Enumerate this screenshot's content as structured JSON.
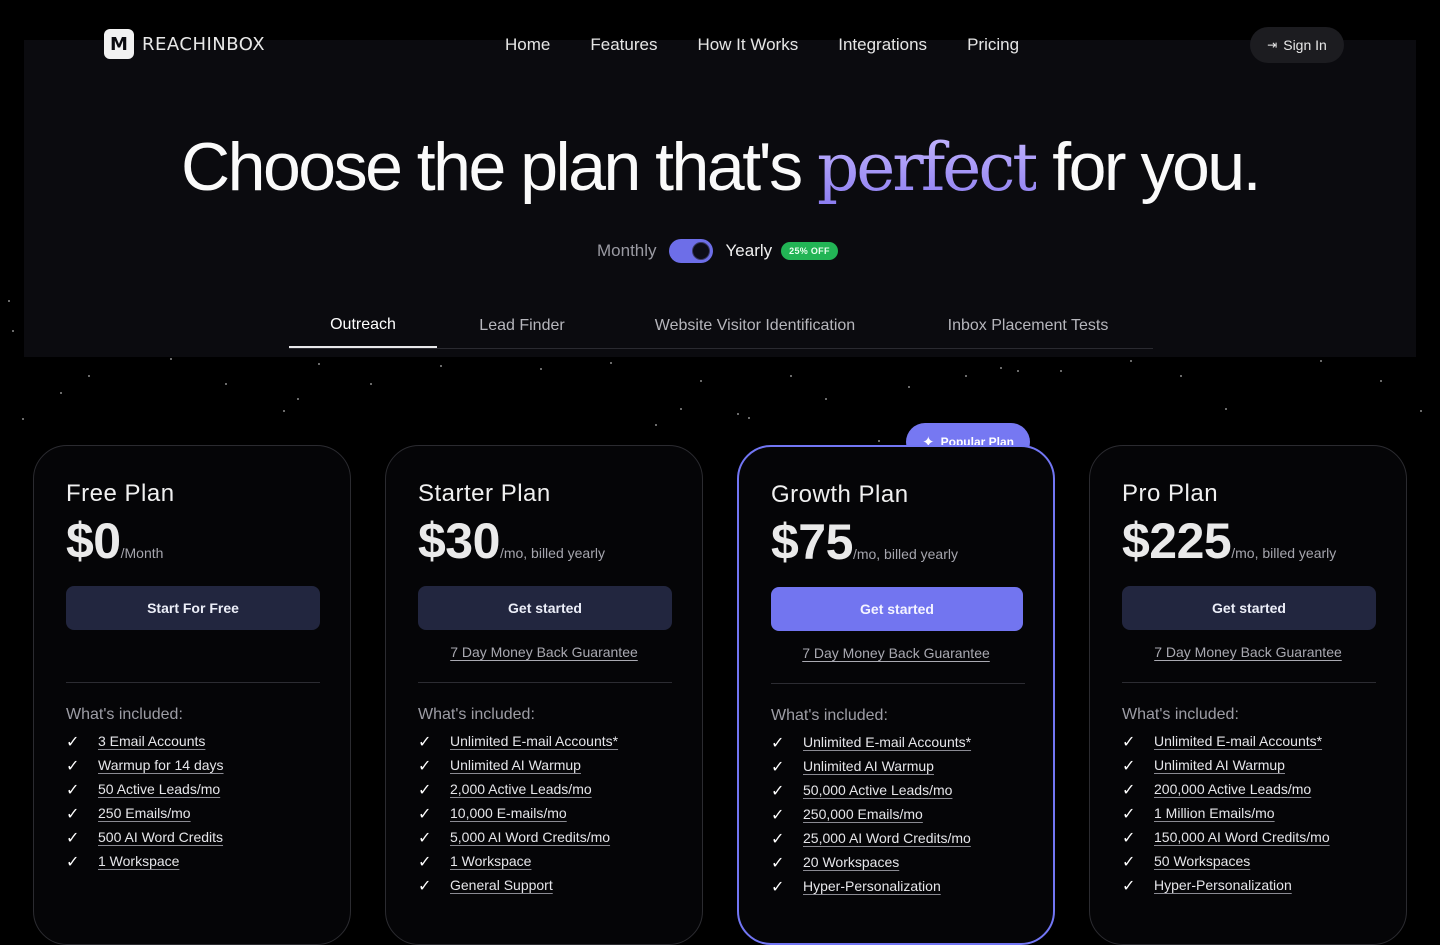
{
  "brand": {
    "logo_letter": "M",
    "name": "REACHINBOX"
  },
  "nav": [
    "Home",
    "Features",
    "How It Works",
    "Integrations",
    "Pricing"
  ],
  "signin": {
    "label": "Sign In",
    "icon": "sign-in-icon"
  },
  "hero": {
    "title_before": "Choose the plan that's ",
    "title_accent": "perfect",
    "title_after": " for you."
  },
  "billing": {
    "monthly_label": "Monthly",
    "yearly_label": "Yearly",
    "yearly_selected": true,
    "discount_badge": "25% OFF"
  },
  "tabs": [
    {
      "label": "Outreach",
      "active": true
    },
    {
      "label": "Lead Finder",
      "active": false
    },
    {
      "label": "Website Visitor Identification",
      "active": false
    },
    {
      "label": "Inbox Placement Tests",
      "active": false
    }
  ],
  "popular_badge": "Popular Plan",
  "colors": {
    "accent": "#7275f0",
    "badge_green": "#22b455",
    "card_button": "#22263f",
    "title_accent": "#9e8cf0"
  },
  "plans": [
    {
      "name": "Free Plan",
      "price": "$0",
      "period": "/Month",
      "cta": "Start For Free",
      "guarantee": "",
      "included_label": "What's included:",
      "features": [
        "3 Email Accounts",
        "Warmup for 14 days",
        "50 Active Leads/mo",
        "250 Emails/mo",
        "500 AI Word Credits",
        "1 Workspace"
      ]
    },
    {
      "name": "Starter Plan",
      "price": "$30",
      "period": "/mo, billed yearly",
      "cta": "Get started",
      "guarantee": "7 Day Money Back Guarantee",
      "included_label": "What's included:",
      "features": [
        "Unlimited E-mail Accounts*",
        "Unlimited AI Warmup",
        "2,000 Active Leads/mo",
        "10,000 E-mails/mo",
        "5,000 AI Word Credits/mo",
        "1 Workspace",
        "General Support"
      ]
    },
    {
      "name": "Growth Plan",
      "price": "$75",
      "period": "/mo, billed yearly",
      "cta": "Get started",
      "guarantee": "7 Day Money Back Guarantee",
      "included_label": "What's included:",
      "features": [
        "Unlimited E-mail Accounts*",
        "Unlimited AI Warmup",
        "50,000 Active Leads/mo",
        "250,000 Emails/mo",
        "25,000 AI Word Credits/mo",
        "20 Workspaces",
        "Hyper-Personalization"
      ]
    },
    {
      "name": "Pro Plan",
      "price": "$225",
      "period": "/mo, billed yearly",
      "cta": "Get started",
      "guarantee": "7 Day Money Back Guarantee",
      "included_label": "What's included:",
      "features": [
        "Unlimited E-mail Accounts*",
        "Unlimited AI Warmup",
        "200,000 Active Leads/mo",
        "1 Million Emails/mo",
        "150,000 AI Word Credits/mo",
        "50 Workspaces",
        "Hyper-Personalization"
      ]
    }
  ]
}
